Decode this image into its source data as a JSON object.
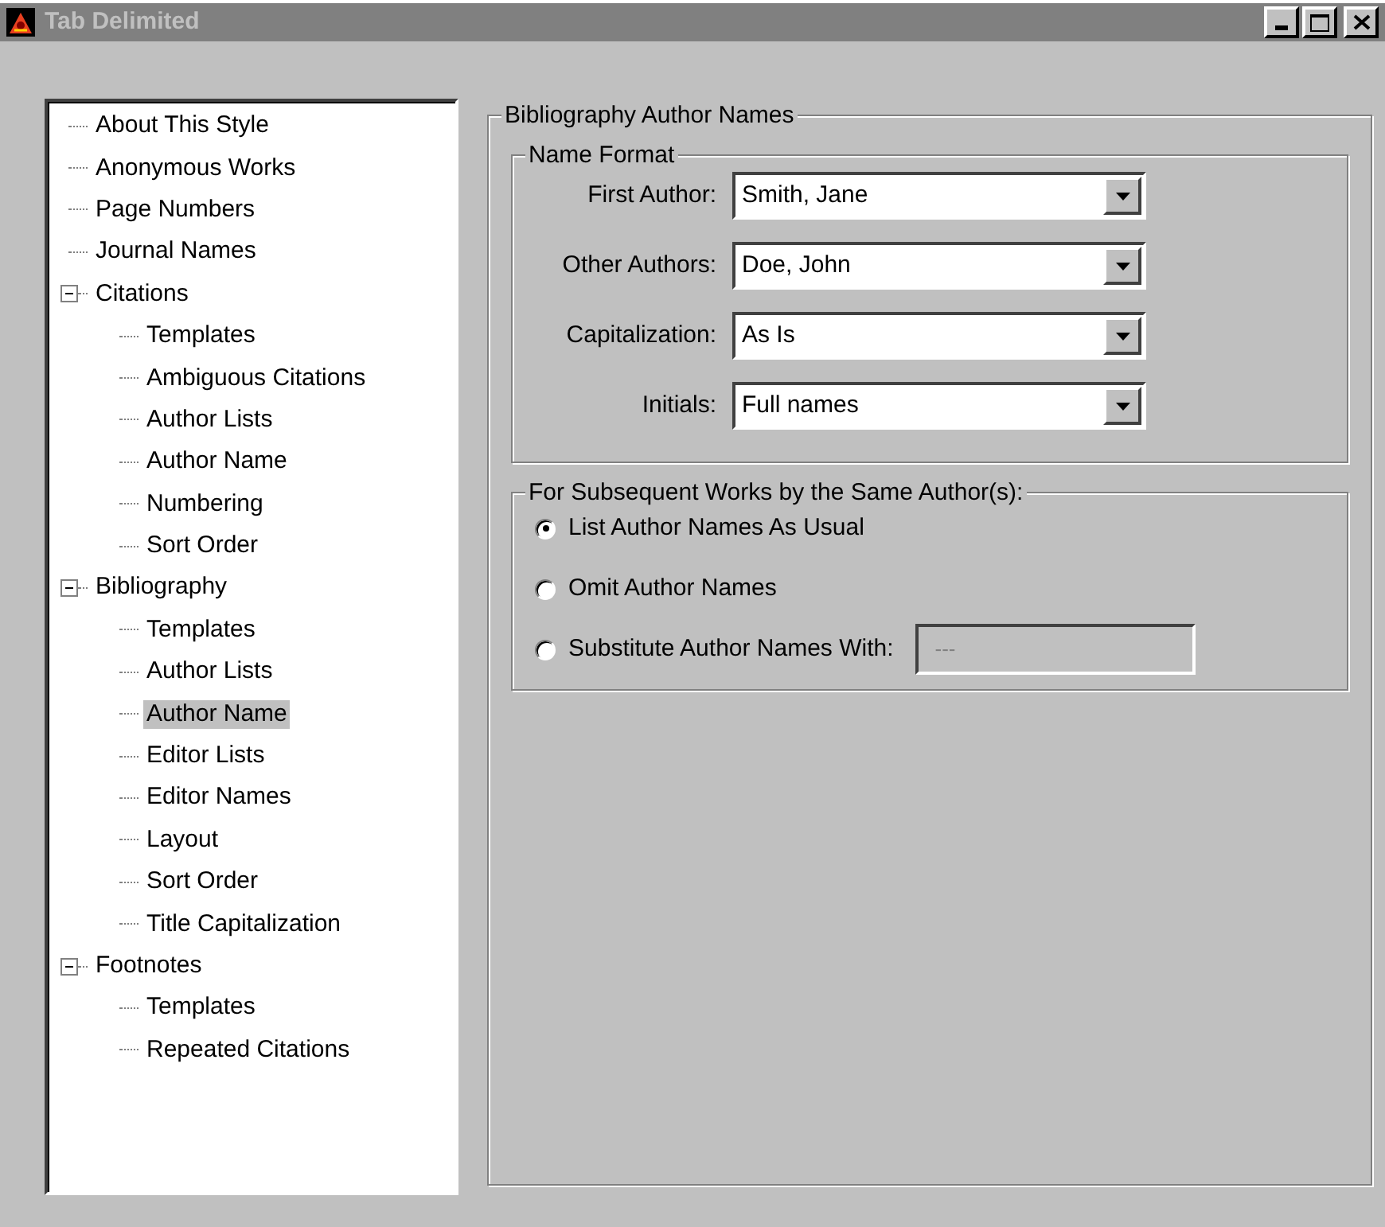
{
  "window": {
    "title": "Tab Delimited",
    "active": false
  },
  "tree": [
    {
      "label": "About This Style",
      "selected": false
    },
    {
      "label": "Anonymous Works",
      "selected": false
    },
    {
      "label": "Page Numbers",
      "selected": false
    },
    {
      "label": "Journal Names",
      "selected": false
    },
    {
      "label": "Citations",
      "selected": false,
      "expanded": true,
      "children": [
        {
          "label": "Templates",
          "selected": false
        },
        {
          "label": "Ambiguous Citations",
          "selected": false
        },
        {
          "label": "Author Lists",
          "selected": false
        },
        {
          "label": "Author Name",
          "selected": false
        },
        {
          "label": "Numbering",
          "selected": false
        },
        {
          "label": "Sort Order",
          "selected": false
        }
      ]
    },
    {
      "label": "Bibliography",
      "selected": false,
      "expanded": true,
      "children": [
        {
          "label": "Templates",
          "selected": false
        },
        {
          "label": "Author Lists",
          "selected": false
        },
        {
          "label": "Author Name",
          "selected": true
        },
        {
          "label": "Editor Lists",
          "selected": false
        },
        {
          "label": "Editor Names",
          "selected": false
        },
        {
          "label": "Layout",
          "selected": false
        },
        {
          "label": "Sort Order",
          "selected": false
        },
        {
          "label": "Title Capitalization",
          "selected": false
        }
      ]
    },
    {
      "label": "Footnotes",
      "selected": false,
      "expanded": true,
      "children": [
        {
          "label": "Templates",
          "selected": false
        },
        {
          "label": "Repeated Citations",
          "selected": false
        }
      ]
    }
  ],
  "panel": {
    "title": "Bibliography Author Names",
    "name_format": {
      "title": "Name Format",
      "fields": [
        {
          "label": "First Author:",
          "value": "Smith, Jane"
        },
        {
          "label": "Other Authors:",
          "value": "Doe, John"
        },
        {
          "label": "Capitalization:",
          "value": "As Is"
        },
        {
          "label": "Initials:",
          "value": "Full names"
        }
      ]
    },
    "subsequent": {
      "title": "For Subsequent Works by the Same Author(s):",
      "options": [
        {
          "label": "List Author Names As Usual",
          "selected": true
        },
        {
          "label": "Omit Author Names",
          "selected": false
        },
        {
          "label": "Substitute Author Names With:",
          "selected": false,
          "field": {
            "value": "---",
            "disabled": true
          }
        }
      ]
    }
  }
}
